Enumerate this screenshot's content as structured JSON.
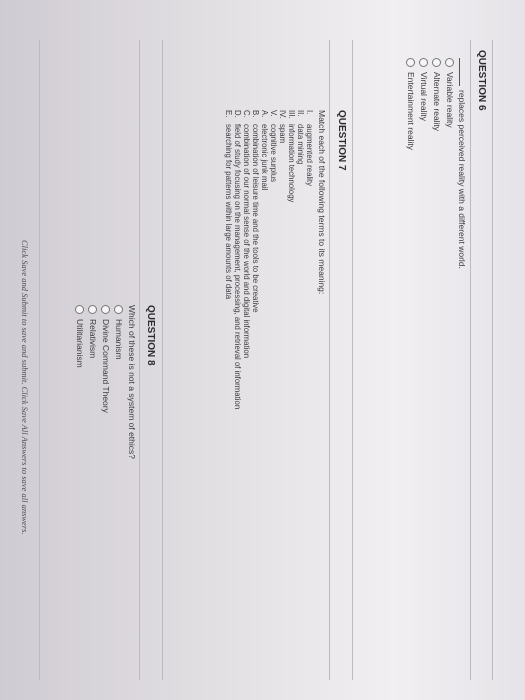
{
  "q6": {
    "title": "QUESTION 6",
    "prompt": "replaces perceived reality with a different world.",
    "options": [
      "Variable reality",
      "Alternate reality",
      "Virtual reality",
      "Entertainment reality"
    ]
  },
  "q7": {
    "title": "QUESTION 7",
    "prompt": "Match each of the following terms to its meaning:",
    "terms": [
      {
        "num": "I.",
        "text": "augmented reality"
      },
      {
        "num": "II.",
        "text": "data mining"
      },
      {
        "num": "III.",
        "text": "information technology"
      },
      {
        "num": "IV.",
        "text": "spam"
      },
      {
        "num": "V.",
        "text": "cognitive surplus"
      }
    ],
    "meanings": [
      {
        "num": "A.",
        "text": "electronic junk mail"
      },
      {
        "num": "B.",
        "text": "combination of leisure time and the tools to be creative"
      },
      {
        "num": "C.",
        "text": "combination of our normal sense of the world and digital information"
      },
      {
        "num": "D.",
        "text": "field of study focusing on the management, processing, and retrieval of information"
      },
      {
        "num": "E.",
        "text": "searching for patterns within large amounts of data"
      }
    ]
  },
  "q8": {
    "title": "QUESTION 8",
    "prompt": "Which of these is not a system of ethics?",
    "options": [
      "Humanism",
      "Divine Command Theory",
      "Relativism",
      "Utilitarianism"
    ]
  },
  "footer": "Click Save and Submit to save and submit. Click Save All Answers to save all answers."
}
